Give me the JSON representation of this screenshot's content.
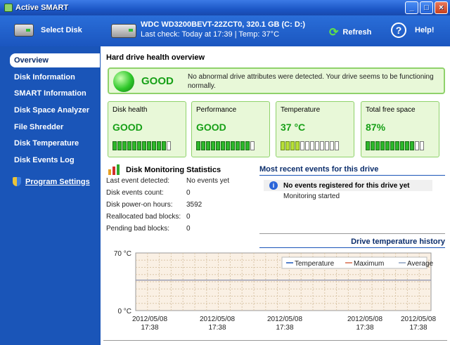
{
  "window": {
    "title": "Active SMART",
    "min": "_",
    "max": "□",
    "close": "×"
  },
  "header": {
    "select_disk": "Select Disk",
    "drive_title": "WDC WD3200BEVT-22ZCT0, 320.1 GB (C: D:)",
    "drive_sub": "Last check: Today at 17:39 | Temp: 37°C",
    "refresh": "Refresh",
    "help": "Help!"
  },
  "sidebar": {
    "items": [
      {
        "label": "Overview"
      },
      {
        "label": "Disk Information"
      },
      {
        "label": "SMART Information"
      },
      {
        "label": "Disk Space Analyzer"
      },
      {
        "label": "File Shredder"
      },
      {
        "label": "Disk Temperature"
      },
      {
        "label": "Disk Events Log"
      }
    ],
    "settings": "Program Settings"
  },
  "overview": {
    "title": "Hard drive health overview",
    "status": "GOOD",
    "message": "No abnormal drive attributes were detected. Your drive seems to be functioning normally."
  },
  "cards": [
    {
      "title": "Disk health",
      "value": "GOOD",
      "level": 0.9
    },
    {
      "title": "Performance",
      "value": "GOOD",
      "level": 0.9
    },
    {
      "title": "Temperature",
      "value": "37 °C",
      "level": 0.3
    },
    {
      "title": "Total free space",
      "value": "87%",
      "level": 0.87
    }
  ],
  "stats": {
    "title": "Disk Monitoring Statistics",
    "rows": [
      {
        "label": "Last event detected:",
        "value": "No events yet"
      },
      {
        "label": "Disk events count:",
        "value": "0"
      },
      {
        "label": "Disk power-on hours:",
        "value": "3592"
      },
      {
        "label": "Reallocated bad blocks:",
        "value": "0"
      },
      {
        "label": "Pending bad blocks:",
        "value": "0"
      }
    ]
  },
  "events": {
    "title": "Most recent events for this drive",
    "main": "No events registered for this drive yet",
    "sub": "Monitoring started"
  },
  "chart_data": {
    "type": "line",
    "title": "Drive temperature history",
    "ylabel": "",
    "xlabel": "",
    "y_ticks": [
      "70 °C",
      "0 °C"
    ],
    "ylim": [
      0,
      70
    ],
    "x_ticks": [
      [
        "2012/05/08",
        "17:38"
      ],
      [
        "2012/05/08",
        "17:38"
      ],
      [
        "2012/05/08",
        "17:38"
      ],
      [
        "2012/05/08",
        "17:38"
      ],
      [
        "2012/05/08",
        "17:38"
      ]
    ],
    "series": [
      {
        "name": "Temperature",
        "color": "#1a55b8",
        "values": [
          37,
          37
        ]
      },
      {
        "name": "Maximum",
        "color": "#d96a4a",
        "values": [
          37,
          37
        ]
      },
      {
        "name": "Average",
        "color": "#8aa0c0",
        "values": [
          37,
          37
        ]
      }
    ],
    "grid": true,
    "legend": "top-right"
  }
}
